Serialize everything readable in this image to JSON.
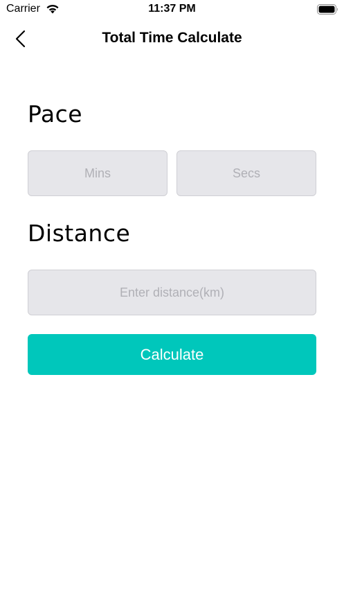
{
  "status_bar": {
    "carrier": "Carrier",
    "time": "11:37 PM"
  },
  "nav": {
    "title": "Total Time Calculate"
  },
  "pace": {
    "title": "Pace",
    "mins_placeholder": "Mins",
    "secs_placeholder": "Secs"
  },
  "distance": {
    "title": "Distance",
    "placeholder": "Enter distance(km)"
  },
  "actions": {
    "calculate_label": "Calculate"
  },
  "colors": {
    "accent": "#00c7bb",
    "input_background": "#e6e6ea",
    "placeholder": "#b0b0b6"
  }
}
